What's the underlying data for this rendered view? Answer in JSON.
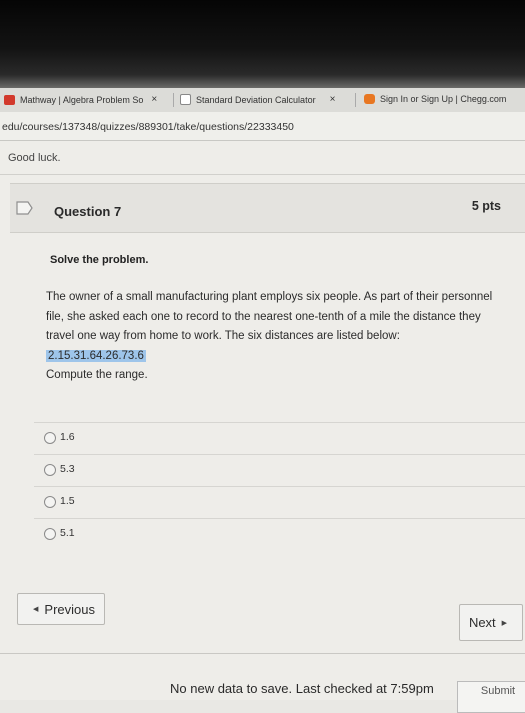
{
  "browser": {
    "tabs": [
      {
        "label": "Mathway | Algebra Problem So",
        "close": "×"
      },
      {
        "label": "Standard Deviation Calculator",
        "close": "×"
      },
      {
        "label": "Sign In or Sign Up | Chegg.com"
      }
    ],
    "url": "edu/courses/137348/quizzes/889301/take/questions/22333450"
  },
  "quiz": {
    "message": "Good luck.",
    "question": {
      "title": "Question 7",
      "points": "5 pts",
      "instruction": "Solve the problem.",
      "paragraph": "The owner of a small manufacturing plant employs six people. As part of their personnel file, she asked each one to record to the nearest one-tenth of a mile the distance they travel one way from home to work. The six distances are listed below:",
      "data_line": "2.15.31.64.26.73.6",
      "prompt": "Compute the range."
    },
    "answers": [
      "1.6",
      "5.3",
      "1.5",
      "5.1"
    ]
  },
  "nav": {
    "previous": "Previous",
    "next": "Next",
    "status": "No new data to save. Last checked at 7:59pm",
    "submit": "Submit"
  },
  "colors": {
    "highlight": "#9ec5ea",
    "mathway_red": "#d2392c",
    "chegg_orange": "#e87722"
  }
}
